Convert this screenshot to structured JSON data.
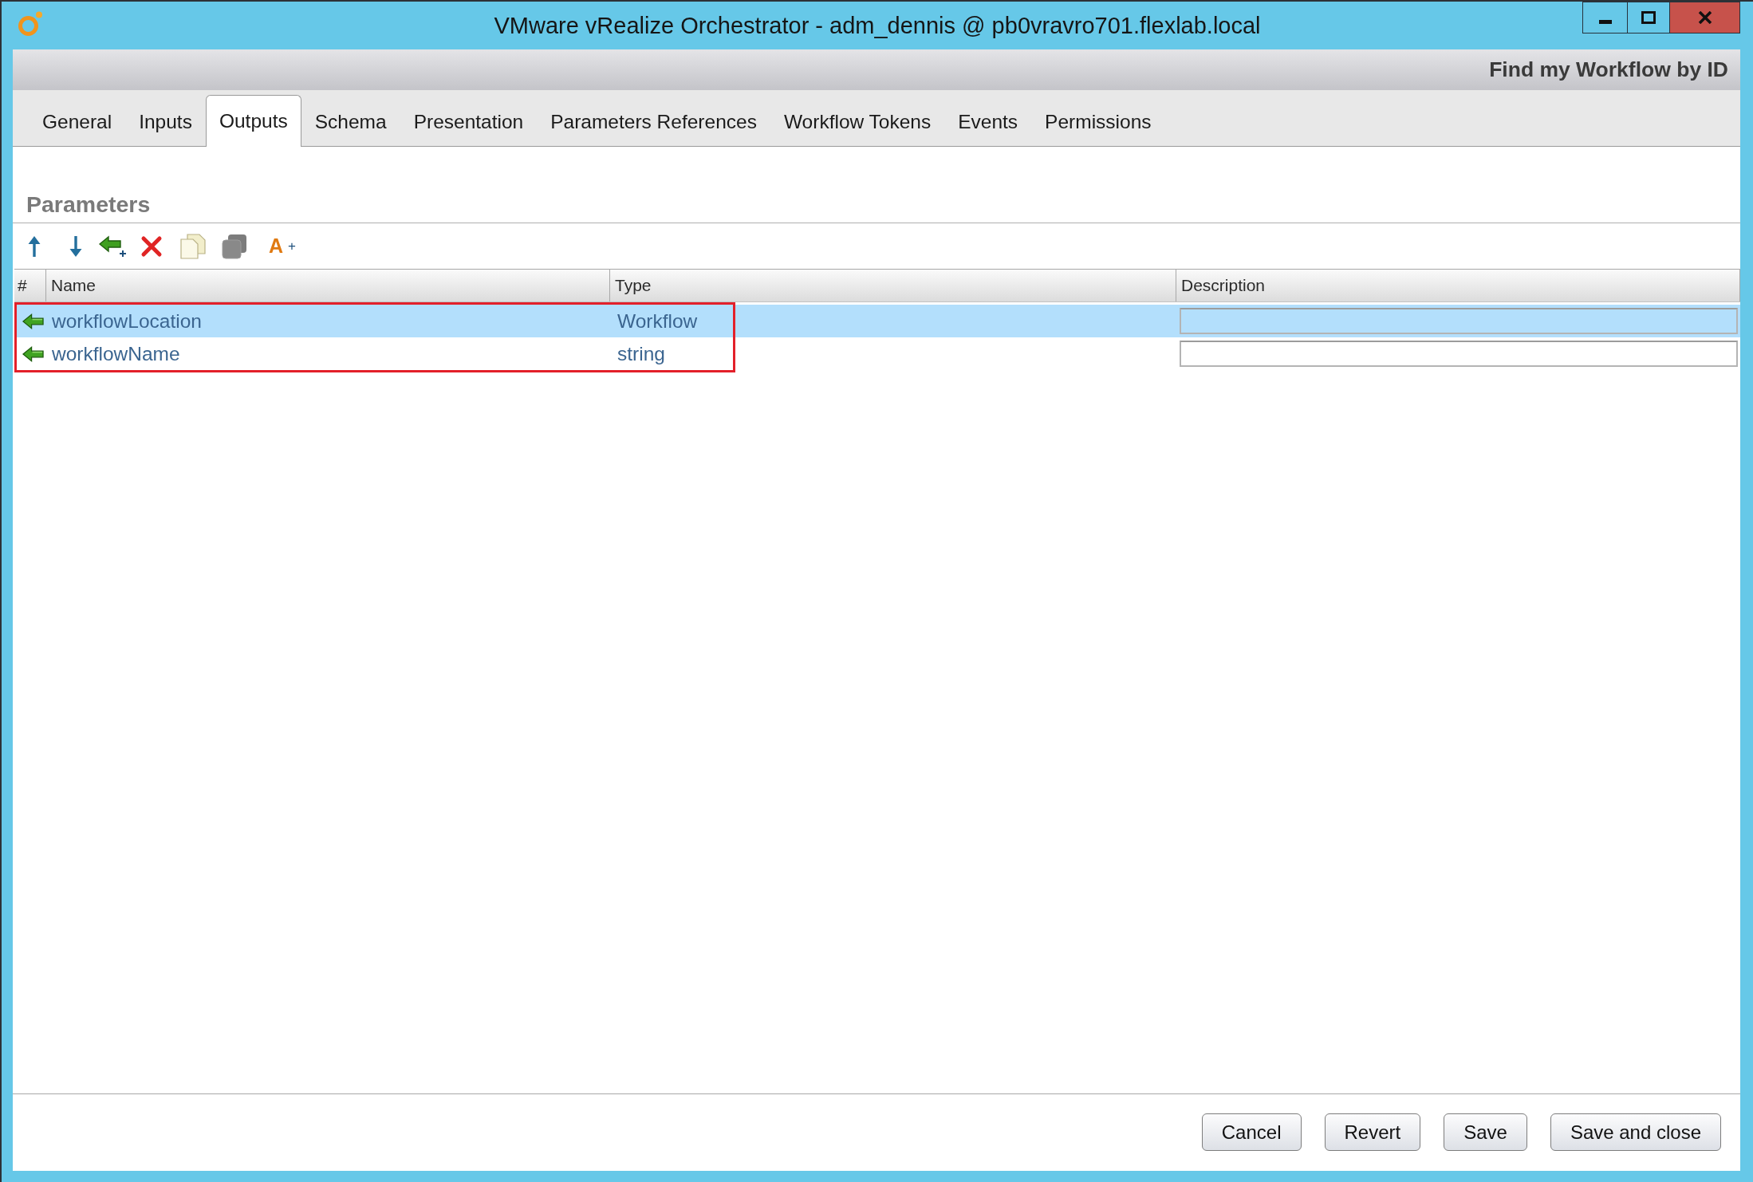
{
  "window": {
    "title": "VMware vRealize Orchestrator - adm_dennis @ pb0vravro701.flexlab.local"
  },
  "header": {
    "title": "Find my Workflow by ID"
  },
  "tabs": [
    {
      "label": "General",
      "selected": false
    },
    {
      "label": "Inputs",
      "selected": false
    },
    {
      "label": "Outputs",
      "selected": true
    },
    {
      "label": "Schema",
      "selected": false
    },
    {
      "label": "Presentation",
      "selected": false
    },
    {
      "label": "Parameters References",
      "selected": false
    },
    {
      "label": "Workflow Tokens",
      "selected": false
    },
    {
      "label": "Events",
      "selected": false
    },
    {
      "label": "Permissions",
      "selected": false
    }
  ],
  "parameters": {
    "heading": "Parameters",
    "toolbar": [
      {
        "kind": "move-up",
        "disabled": false
      },
      {
        "kind": "move-down",
        "disabled": false
      },
      {
        "kind": "add",
        "disabled": false
      },
      {
        "kind": "delete",
        "disabled": false
      },
      {
        "kind": "copy",
        "disabled": false
      },
      {
        "kind": "paste",
        "disabled": true
      },
      {
        "kind": "attribute",
        "glyph": "A",
        "suffix": "+",
        "disabled": false
      }
    ],
    "columns": [
      "#",
      "Name",
      "Type",
      "Description"
    ],
    "rows": [
      {
        "name": "workflowLocation",
        "type": "Workflow",
        "selected": true
      },
      {
        "name": "workflowName",
        "type": "string",
        "selected": false
      }
    ]
  },
  "buttons": [
    "Cancel",
    "Revert",
    "Save",
    "Save and close"
  ]
}
